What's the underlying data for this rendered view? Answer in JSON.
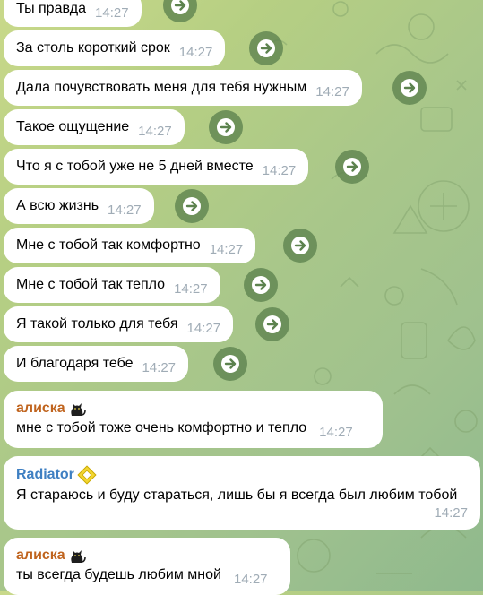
{
  "colors": {
    "bubble_bg": "#ffffff",
    "time_color": "#a0acb6",
    "forward_button": "#5c824e",
    "sender_orange": "#c0641e",
    "sender_blue": "#3e7fc2"
  },
  "outgoing_forwarded": [
    {
      "text": "Ты правда",
      "time": "14:27"
    },
    {
      "text": "За столь короткий срок",
      "time": "14:27"
    },
    {
      "text": "Дала почувствовать меня для тебя нужным",
      "time": "14:27"
    },
    {
      "text": "Такое ощущение",
      "time": "14:27"
    },
    {
      "text": "Что я с тобой уже не 5 дней вместе",
      "time": "14:27"
    },
    {
      "text": "А всю жизнь",
      "time": "14:27"
    },
    {
      "text": "Мне с тобой так комфортно",
      "time": "14:27"
    },
    {
      "text": "Мне с тобой так тепло",
      "time": "14:27"
    },
    {
      "text": "Я такой только для тебя",
      "time": "14:27"
    },
    {
      "text": "И благодаря тебе",
      "time": "14:27"
    }
  ],
  "messages": [
    {
      "sender": "алиска",
      "sender_icon": "black-cat-emoji",
      "text": "мне с тобой тоже очень комфортно и тепло",
      "time": "14:27"
    },
    {
      "sender": "Radiator",
      "sender_icon": "yellow-diamond-badge",
      "text": "Я стараюсь и буду стараться, лишь бы я всегда был любим тобой",
      "time": "14:27"
    },
    {
      "sender": "алиска",
      "sender_icon": "black-cat-emoji",
      "text": "ты всегда будешь любим мной",
      "time": "14:27"
    }
  ]
}
